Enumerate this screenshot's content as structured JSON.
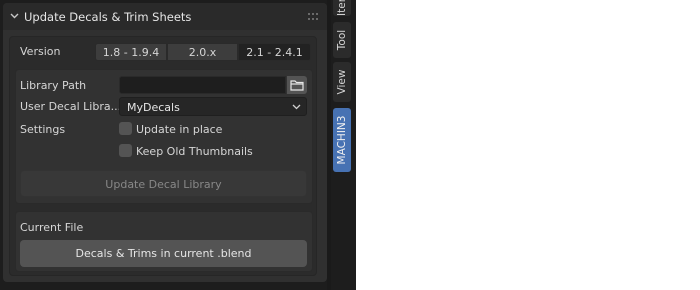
{
  "panel": {
    "title": "Update Decals & Trim Sheets"
  },
  "version": {
    "label": "Version",
    "options": [
      "1.8 - 1.9.4",
      "2.0.x",
      "2.1 - 2.4.1"
    ],
    "selected": "2.1 - 2.4.1"
  },
  "library": {
    "path_label": "Library Path",
    "path_value": "",
    "user_decal_label": "User Decal Libra...",
    "user_decal_value": "MyDecals",
    "settings_label": "Settings",
    "update_in_place_label": "Update in place",
    "update_in_place_checked": false,
    "keep_thumbnails_label": "Keep Old Thumbnails",
    "keep_thumbnails_checked": false,
    "update_button": "Update Decal Library"
  },
  "current_file": {
    "label": "Current File",
    "button": "Decals & Trims in current .blend"
  },
  "sidebar_tabs": [
    {
      "label": "Item",
      "active": false
    },
    {
      "label": "Tool",
      "active": false
    },
    {
      "label": "View",
      "active": false
    },
    {
      "label": "MACHIN3",
      "active": true
    }
  ],
  "colors": {
    "accent": "#4772b3",
    "panel_bg": "#303030",
    "area_bg": "#1d1d1d"
  }
}
